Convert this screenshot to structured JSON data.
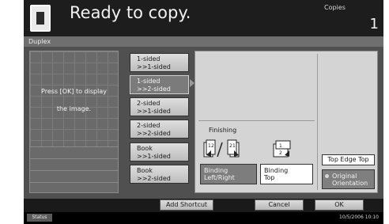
{
  "header": {
    "status_message": "Ready to copy.",
    "copies_label": "Copies",
    "copies_value": "1"
  },
  "title": "Duplex",
  "preview": {
    "message_line1": "Press [OK] to display",
    "message_line2": "the image."
  },
  "options": [
    {
      "line1": "1-sided",
      "line2": ">>1-sided",
      "selected": false
    },
    {
      "line1": "1-sided",
      "line2": ">>2-sided",
      "selected": true
    },
    {
      "line1": "2-sided",
      "line2": ">>1-sided",
      "selected": false
    },
    {
      "line1": "2-sided",
      "line2": ">>2-sided",
      "selected": false
    },
    {
      "line1": "Book",
      "line2": ">>1-sided",
      "selected": false
    },
    {
      "line1": "Book",
      "line2": ">>2-sided",
      "selected": false
    }
  ],
  "finishing": {
    "label": "Finishing",
    "binding_left_right_line1": "Binding",
    "binding_left_right_line2": "Left/Right",
    "binding_top_line1": "Binding",
    "binding_top_line2": "Top",
    "binding_left_right_selected": true
  },
  "orientation": {
    "top_edge_top": "Top Edge Top",
    "original_line1": "Original",
    "original_line2": "Orientation"
  },
  "footer": {
    "add_shortcut": "Add Shortcut",
    "cancel": "Cancel",
    "ok": "OK"
  },
  "statusbar": {
    "status_label": "Status",
    "datetime": "10/5/2006   10:10"
  },
  "colors": {
    "panel": "#505050",
    "selected": "#7b7b7b",
    "header": "#1d1d1d"
  }
}
